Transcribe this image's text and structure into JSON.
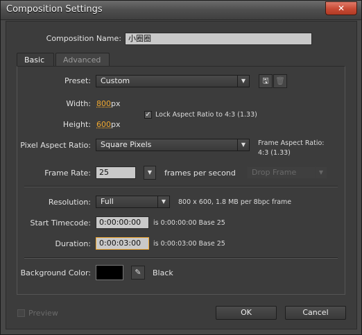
{
  "window": {
    "title": "Composition Settings",
    "close_glyph": "✕"
  },
  "composition_name": {
    "label": "Composition Name:",
    "value": "小圈圈"
  },
  "tabs": [
    {
      "label": "Basic"
    },
    {
      "label": "Advanced"
    }
  ],
  "preset": {
    "label": "Preset:",
    "value": "Custom"
  },
  "width": {
    "label": "Width:",
    "value": "800",
    "unit": "px"
  },
  "height": {
    "label": "Height:",
    "value": "600",
    "unit": "px"
  },
  "lock_aspect": {
    "label": "Lock Aspect Ratio to 4:3 (1.33)",
    "checked": true
  },
  "pixel_aspect": {
    "label": "Pixel Aspect Ratio:",
    "value": "Square Pixels"
  },
  "frame_aspect": {
    "label": "Frame Aspect Ratio:",
    "value": "4:3 (1.33)"
  },
  "frame_rate": {
    "label": "Frame Rate:",
    "value": "25",
    "unit": "frames per second",
    "drop_frame": "Drop Frame"
  },
  "resolution": {
    "label": "Resolution:",
    "value": "Full",
    "info": "800 x 600, 1.8 MB per 8bpc frame"
  },
  "start_timecode": {
    "label": "Start Timecode:",
    "value": "0:00:00:00",
    "info": "is 0:00:00:00  Base 25"
  },
  "duration": {
    "label": "Duration:",
    "value": "0:00:03:00",
    "info": "is 0:00:03:00  Base 25"
  },
  "background": {
    "label": "Background Color:",
    "name": "Black",
    "color": "#000000"
  },
  "preview": {
    "label": "Preview",
    "checked": false
  },
  "buttons": {
    "ok": "OK",
    "cancel": "Cancel"
  },
  "icons": {
    "save_preset": "save-icon",
    "delete_preset": "trash-icon",
    "eyedropper": "eyedropper-icon"
  }
}
